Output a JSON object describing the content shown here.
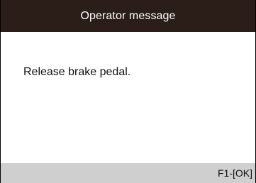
{
  "header": {
    "title": "Operator message"
  },
  "main": {
    "message": "Release brake pedal."
  },
  "footer": {
    "softkey_ok": "F1-[OK]"
  },
  "colors": {
    "header_bg": "#2b1d17",
    "footer_bg": "#cfcfcf",
    "body_bg": "#ffffff"
  }
}
